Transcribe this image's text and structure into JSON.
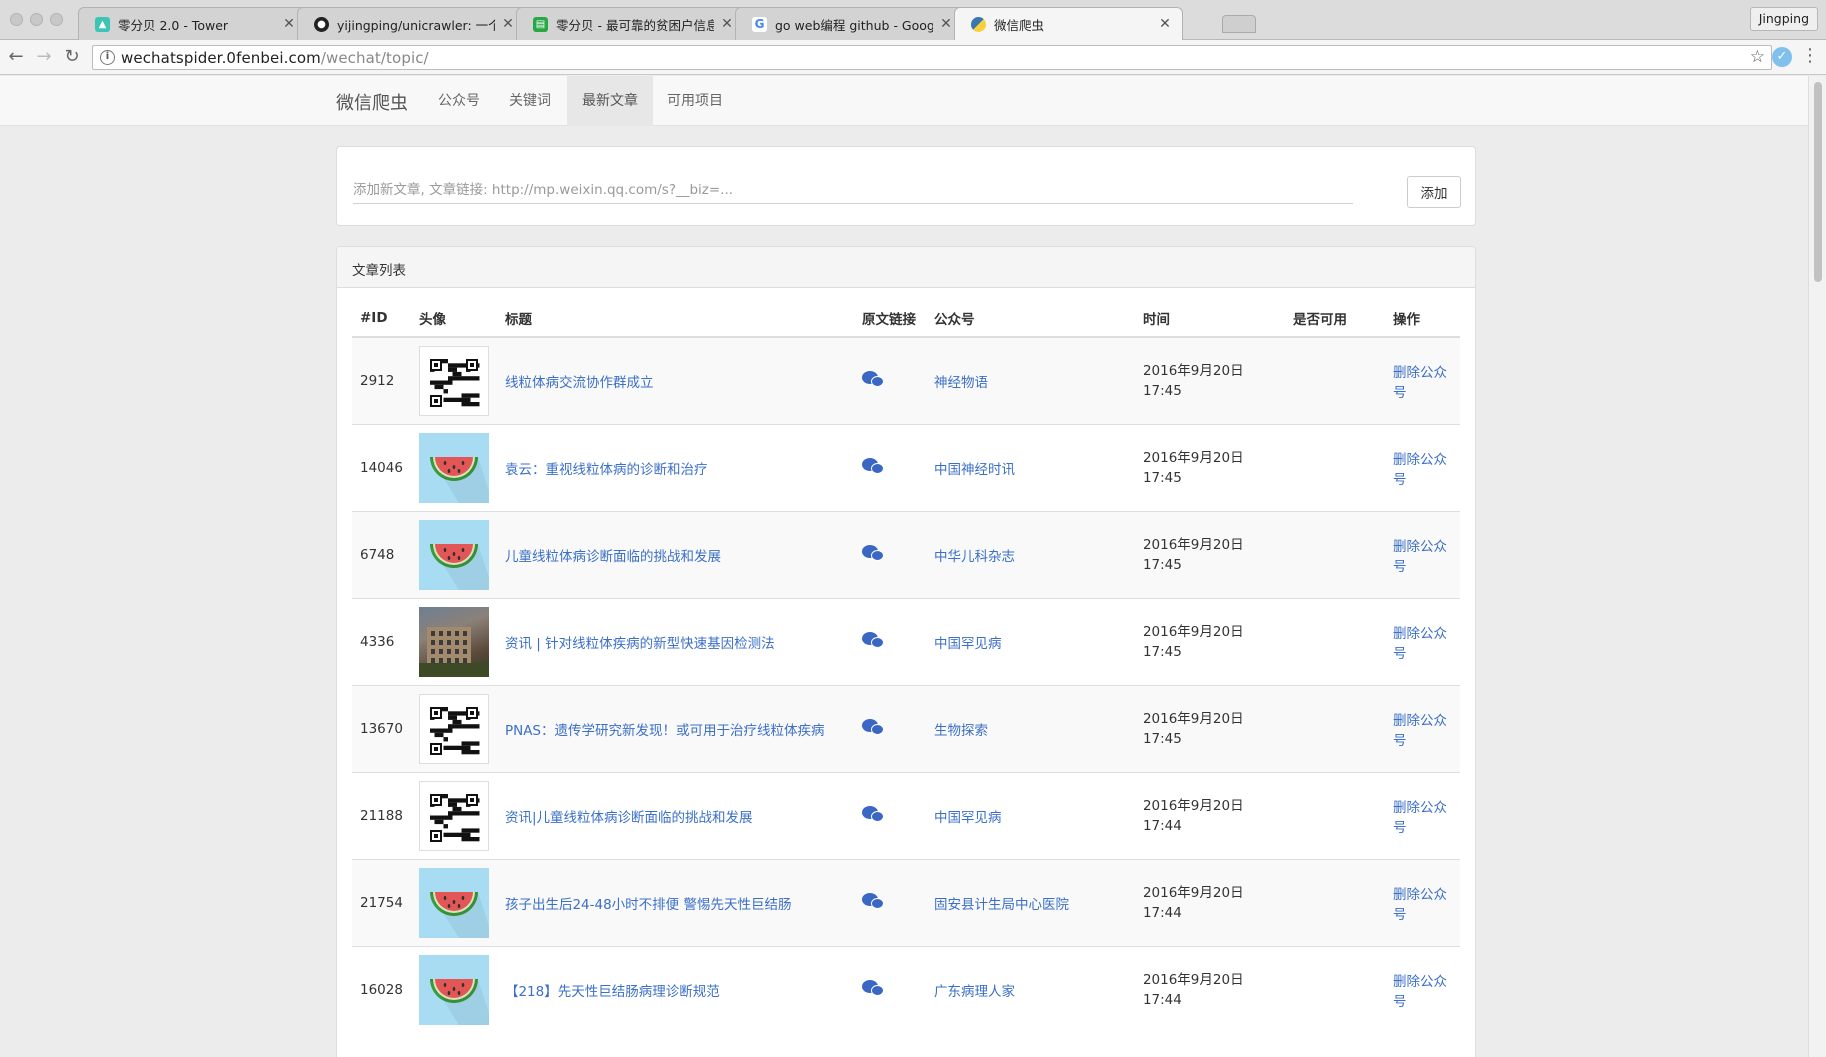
{
  "browser": {
    "tabs": [
      {
        "title": "零分贝 2.0 - Tower",
        "favicon": "tower-icon",
        "active": false
      },
      {
        "title": "yijingping/unicrawler: 一个可配",
        "favicon": "github-icon",
        "active": false
      },
      {
        "title": "零分贝 - 最可靠的贫困户信息平",
        "favicon": "doc-icon",
        "active": false
      },
      {
        "title": "go web编程 github - Google 搜",
        "favicon": "google-icon",
        "active": false
      },
      {
        "title": "微信爬虫",
        "favicon": "python-icon",
        "active": true
      }
    ],
    "profile_name": "Jingping",
    "url_host": "wechatspider.0fenbei.com",
    "url_path": "/wechat/topic/"
  },
  "site": {
    "brand": "微信爬虫",
    "nav": [
      {
        "label": "公众号",
        "active": false
      },
      {
        "label": "关键词",
        "active": false
      },
      {
        "label": "最新文章",
        "active": true
      },
      {
        "label": "可用项目",
        "active": false
      }
    ]
  },
  "add_form": {
    "placeholder": "添加新文章, 文章链接: http://mp.weixin.qq.com/s?__biz=...",
    "button_label": "添加"
  },
  "article_list": {
    "heading": "文章列表",
    "columns": [
      "#ID",
      "头像",
      "标题",
      "原文链接",
      "公众号",
      "时间",
      "是否可用",
      "操作"
    ],
    "rows": [
      {
        "id": "2912",
        "avatar": "qr-code",
        "title": "线粒体病交流协作群成立",
        "account": "神经物语",
        "date": "2016年9月20日",
        "time": "17:45",
        "action": "删除公众号"
      },
      {
        "id": "14046",
        "avatar": "watermelon",
        "title": "袁云：重视线粒体病的诊断和治疗",
        "account": "中国神经时讯",
        "date": "2016年9月20日",
        "time": "17:45",
        "action": "删除公众号"
      },
      {
        "id": "6748",
        "avatar": "watermelon",
        "title": "儿童线粒体病诊断面临的挑战和发展",
        "account": "中华儿科杂志",
        "date": "2016年9月20日",
        "time": "17:45",
        "action": "删除公众号"
      },
      {
        "id": "4336",
        "avatar": "building-photo",
        "title": "资讯 | 针对线粒体疾病的新型快速基因检测法",
        "account": "中国罕见病",
        "date": "2016年9月20日",
        "time": "17:45",
        "action": "删除公众号"
      },
      {
        "id": "13670",
        "avatar": "qr-code",
        "title": "PNAS：遗传学研究新发现！或可用于治疗线粒体疾病",
        "account": "生物探索",
        "date": "2016年9月20日",
        "time": "17:45",
        "action": "删除公众号"
      },
      {
        "id": "21188",
        "avatar": "qr-code",
        "title": "资讯|儿童线粒体病诊断面临的挑战和发展",
        "account": "中国罕见病",
        "date": "2016年9月20日",
        "time": "17:44",
        "action": "删除公众号"
      },
      {
        "id": "21754",
        "avatar": "watermelon",
        "title": "孩子出生后24-48小时不排便 警惕先天性巨结肠",
        "account": "固安县计生局中心医院",
        "date": "2016年9月20日",
        "time": "17:44",
        "action": "删除公众号"
      },
      {
        "id": "16028",
        "avatar": "watermelon",
        "title": "【218】先天性巨结肠病理诊断规范",
        "account": "广东病理人家",
        "date": "2016年9月20日",
        "time": "17:44",
        "action": "删除公众号"
      }
    ]
  },
  "colors": {
    "link": "#3b6fc8",
    "wechat_icon": "#3a66c4",
    "watermelon_bg": "#a8dcf3"
  }
}
